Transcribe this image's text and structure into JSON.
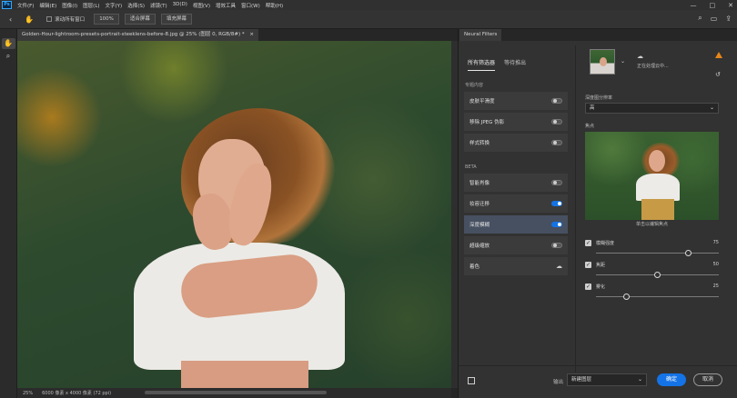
{
  "app": {
    "logo": "Ps"
  },
  "menu": [
    "文件(F)",
    "编辑(E)",
    "图像(I)",
    "图层(L)",
    "文字(Y)",
    "选择(S)",
    "滤镜(T)",
    "3D(D)",
    "视图(V)",
    "增效工具",
    "窗口(W)",
    "帮助(H)"
  ],
  "window_controls": {
    "minimize": "—",
    "maximize": "□",
    "close": "✕"
  },
  "options_bar": {
    "scroll_all_label": "滚动所有窗口",
    "zoom_100": "100%",
    "fit_screen": "适合屏幕",
    "fill_screen": "填充屏幕"
  },
  "document": {
    "tab_title": "Golden-Hour-lightroom-presets-portrait-steeklens-before-8.jpg @ 25% (图层 0, RGB/8#) *",
    "tab_close": "×",
    "zoom": "25%",
    "info": "6000 像素 x 4000 像素 (72 ppi)"
  },
  "neural_filters": {
    "panel_tab": "Neural Filters",
    "tabs": [
      "所有筛选器",
      "等待推出"
    ],
    "sections": {
      "featured": "专题内容",
      "beta": "BETA"
    },
    "featured_filters": [
      {
        "label": "皮肤平滑度",
        "state": "off"
      },
      {
        "label": "移除 JPEG 伪影",
        "state": "off"
      },
      {
        "label": "样式转换",
        "state": "off"
      }
    ],
    "beta_filters": [
      {
        "label": "智能肖像",
        "state": "off"
      },
      {
        "label": "妆容迁移",
        "state": "on"
      },
      {
        "label": "深度模糊",
        "state": "on"
      },
      {
        "label": "超级缩放",
        "state": "off"
      },
      {
        "label": "着色",
        "state": "download"
      }
    ],
    "right": {
      "cloud_text": "正在处理云中...",
      "resolution_label": "深度图分辨率",
      "resolution_value": "高",
      "focus_label": "焦点",
      "preview_caption": "单击以编辑焦点",
      "sliders": [
        {
          "label": "模糊强度",
          "value": "75",
          "fraction": 0.75
        },
        {
          "label": "焦距",
          "value": "50",
          "fraction": 0.5
        },
        {
          "label": "雾化",
          "value": "25",
          "fraction": 0.25
        }
      ]
    },
    "bottom": {
      "output_label": "输出",
      "output_value": "新建图层",
      "ok": "确定",
      "cancel": "取消"
    }
  },
  "colors": {
    "accent": "#1473e6",
    "warning": "#e68619"
  }
}
